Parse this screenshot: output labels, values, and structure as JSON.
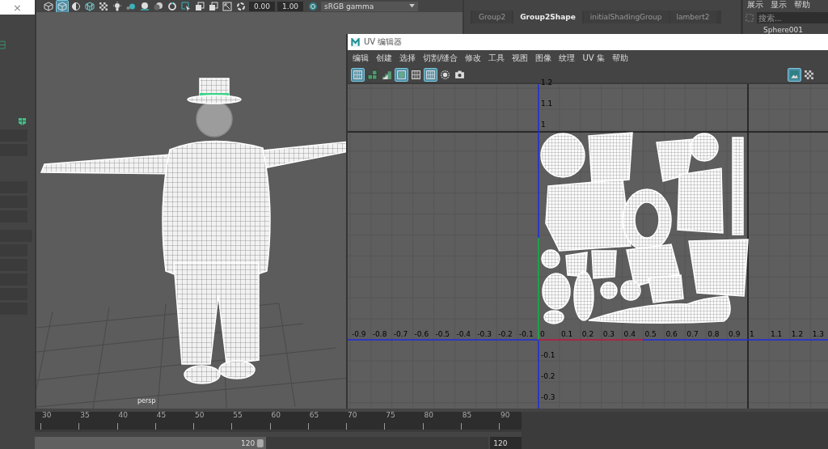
{
  "left_panel": {
    "close": "×"
  },
  "viewport_toolbar": {
    "tools": [
      {
        "kind": "cube",
        "selected": false
      },
      {
        "kind": "cube",
        "selected": true
      },
      {
        "kind": "half",
        "selected": false
      },
      {
        "kind": "wirecube",
        "selected": false
      },
      {
        "kind": "checker",
        "selected": false
      },
      {
        "kind": "bulb",
        "selected": false
      },
      {
        "kind": "teal",
        "selected": false
      },
      {
        "kind": "sphere",
        "selected": false
      },
      {
        "kind": "spheres",
        "selected": false
      },
      {
        "kind": "ring",
        "selected": false
      },
      {
        "kind": "select",
        "selected": false
      },
      {
        "kind": "squares",
        "selected": false
      },
      {
        "kind": "squares",
        "selected": false
      },
      {
        "kind": "resize",
        "selected": false
      },
      {
        "kind": "aperture",
        "selected": false
      }
    ],
    "exposure": "0.00",
    "gamma": "1.00",
    "color_space": "sRGB gamma"
  },
  "viewport": {
    "camera": "persp"
  },
  "attribute_tabs": [
    {
      "label": "Group2",
      "selected": false
    },
    {
      "label": "Group2Shape",
      "selected": true
    },
    {
      "label": "initialShadingGroup",
      "selected": false
    },
    {
      "label": "lambert2",
      "selected": false
    }
  ],
  "outliner": {
    "menu": [
      "展示",
      "显示",
      "帮助"
    ],
    "search": {
      "placeholder": "搜索..."
    },
    "items": [
      "Sphere001"
    ]
  },
  "uv_editor": {
    "title": "UV 编辑器",
    "menu": [
      "编辑",
      "创建",
      "选择",
      "切割/缝合",
      "修改",
      "工具",
      "视图",
      "图像",
      "纹理",
      "UV 集",
      "帮助"
    ],
    "tools": [
      {
        "kind": "grid",
        "selected": true
      },
      {
        "kind": "blocks",
        "selected": false
      },
      {
        "kind": "stairs",
        "selected": false
      },
      {
        "kind": "frame",
        "selected": true
      },
      {
        "kind": "grid",
        "selected": false
      },
      {
        "kind": "grid",
        "selected": true
      },
      {
        "kind": "circle",
        "selected": false
      },
      {
        "kind": "camera",
        "selected": false
      }
    ],
    "right_tools": [
      {
        "kind": "image",
        "selected": true
      },
      {
        "kind": "checker",
        "selected": false
      }
    ],
    "u_ticks": [
      "-0.9",
      "-0.8",
      "-0.7",
      "-0.6",
      "-0.5",
      "-0.4",
      "-0.3",
      "-0.2",
      "-0.1",
      "0",
      "0.1",
      "0.2",
      "0.3",
      "0.4",
      "0.5",
      "0.6",
      "0.7",
      "0.8",
      "0.9",
      "1",
      "1.1",
      "1.2",
      "1.3"
    ],
    "v_ticks": [
      "1.2",
      "1.1",
      "1",
      "-0.1",
      "-0.2",
      "-0.3"
    ]
  },
  "timeline": {
    "ticks": [
      "30",
      "35",
      "40",
      "45",
      "50",
      "55",
      "60",
      "65",
      "70",
      "75",
      "80",
      "85",
      "90"
    ],
    "range": {
      "level": 0.51,
      "end": "120"
    },
    "end_field": "120"
  }
}
